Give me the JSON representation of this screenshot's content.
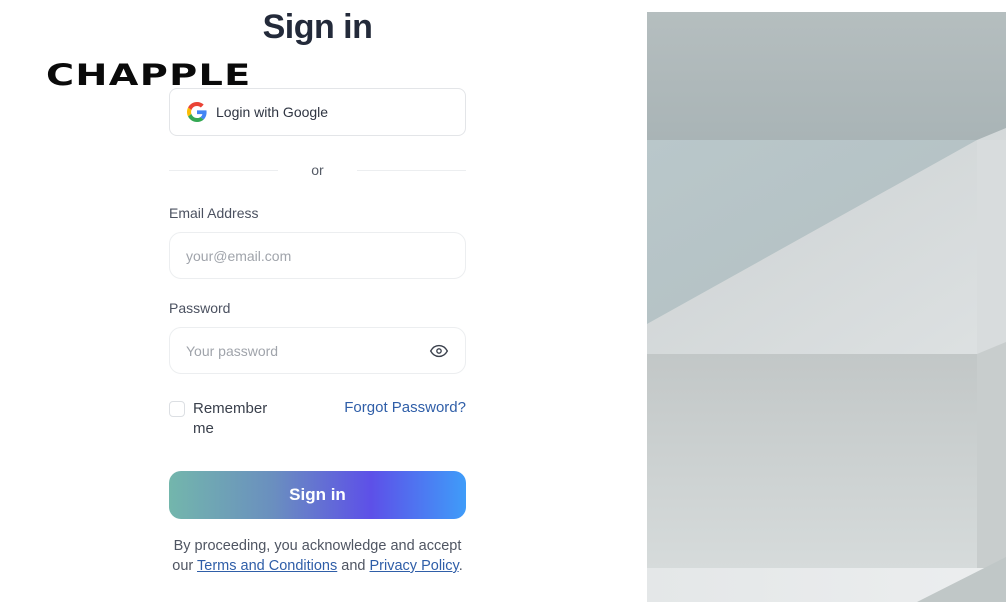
{
  "brand": {
    "logo_text": "CHAPPLE"
  },
  "header": {
    "title": "Sign in"
  },
  "google_login": {
    "label": "Login with Google",
    "icon": "google-g-icon"
  },
  "divider": {
    "text": "or"
  },
  "form": {
    "email": {
      "label": "Email Address",
      "placeholder": "your@email.com",
      "value": ""
    },
    "password": {
      "label": "Password",
      "placeholder": "Your password",
      "value": "",
      "toggle_icon": "eye-icon"
    },
    "remember_me": {
      "label": "Remember me",
      "checked": false
    },
    "forgot_password": {
      "label": "Forgot Password?"
    },
    "submit": {
      "label": "Sign in"
    }
  },
  "legal": {
    "prefix": "By proceeding, you acknowledge and accept our ",
    "terms_label": "Terms and Conditions",
    "middle": " and ",
    "privacy_label": "Privacy Policy",
    "suffix": "."
  },
  "theme": {
    "link_color": "#2f5ea8",
    "button_gradient": [
      "#73b6ac",
      "#5d50e8",
      "#3f9cf9"
    ]
  }
}
